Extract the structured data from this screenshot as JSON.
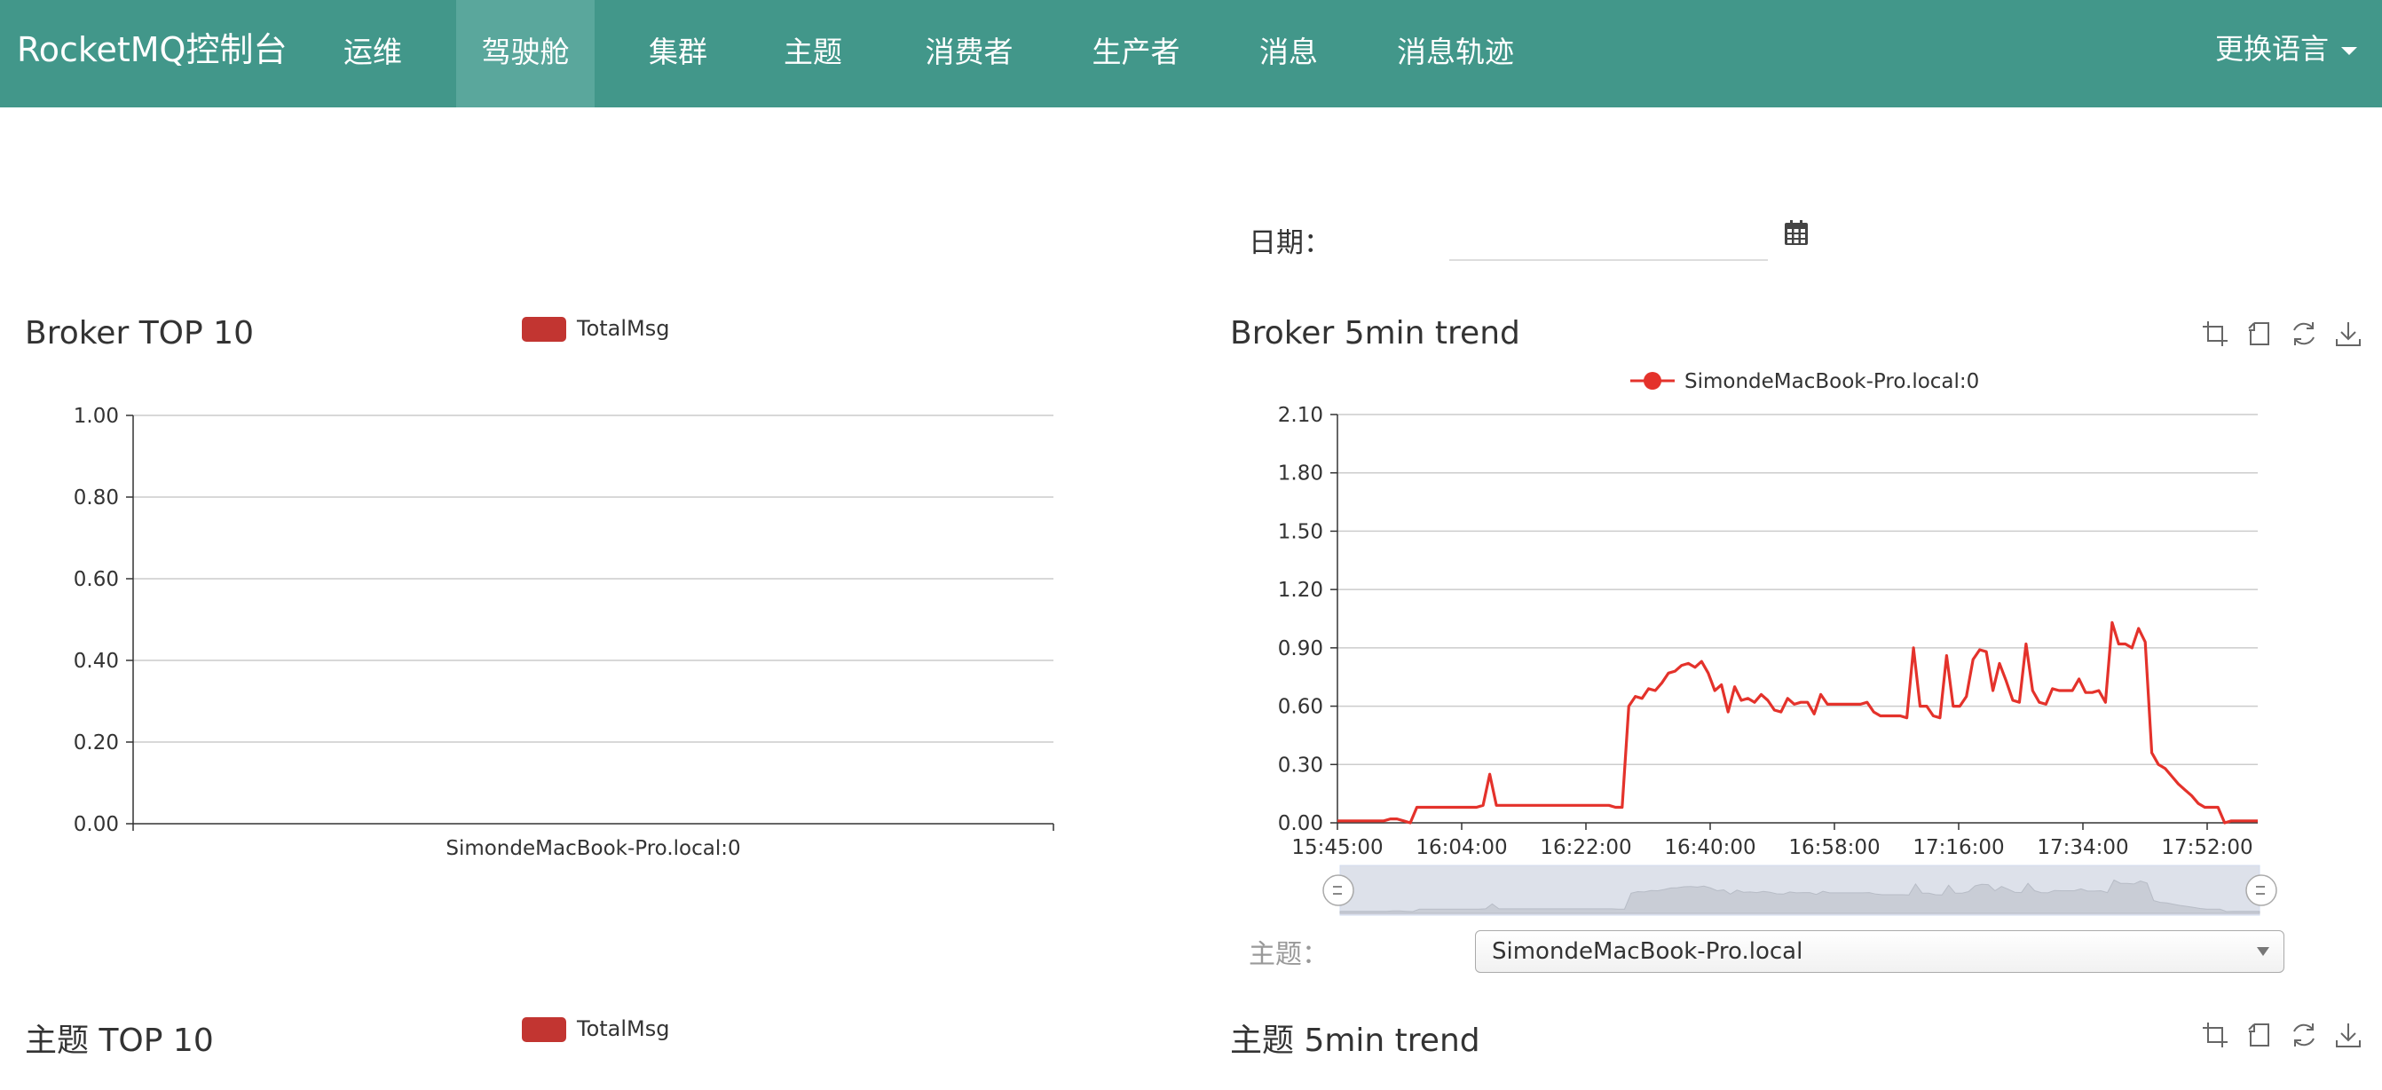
{
  "navbar": {
    "brand": "RocketMQ控制台",
    "items": [
      {
        "label": "运维",
        "active": false
      },
      {
        "label": "驾驶舱",
        "active": true
      },
      {
        "label": "集群",
        "active": false
      },
      {
        "label": "主题",
        "active": false
      },
      {
        "label": "消费者",
        "active": false
      },
      {
        "label": "生产者",
        "active": false
      },
      {
        "label": "消息",
        "active": false
      },
      {
        "label": "消息轨迹",
        "active": false
      }
    ],
    "language_label": "更换语言"
  },
  "date_filter": {
    "label": "日期：",
    "value": "",
    "icon": "calendar-icon"
  },
  "broker_top": {
    "title": "Broker TOP 10",
    "legend": "TotalMsg"
  },
  "broker_trend": {
    "title": "Broker 5min trend",
    "tools": [
      "zoom-icon",
      "zoom-reset-icon",
      "restore-icon",
      "save-image-icon"
    ]
  },
  "topic_filter": {
    "label": "主题：",
    "selected": "SimondeMacBook-Pro.local"
  },
  "topic_top": {
    "title": "主题 TOP 10",
    "legend": "TotalMsg"
  },
  "topic_trend": {
    "title": "主题 5min trend"
  },
  "chart_data": [
    {
      "type": "bar",
      "categories": [
        "SimondeMacBook-Pro.local:0"
      ],
      "series": [
        {
          "name": "TotalMsg",
          "values": [
            0
          ]
        }
      ],
      "ylim": [
        0,
        1
      ],
      "yticks": [
        "0.00",
        "0.20",
        "0.40",
        "0.60",
        "0.80",
        "1.00"
      ],
      "color": "#c23531",
      "legend": "top"
    },
    {
      "type": "line",
      "x_ticks": [
        "15:45:00",
        "16:04:00",
        "16:22:00",
        "16:40:00",
        "16:58:00",
        "17:16:00",
        "17:34:00",
        "17:52:00"
      ],
      "ylim": [
        0,
        2.1
      ],
      "yticks": [
        "0.00",
        "0.30",
        "0.60",
        "0.90",
        "1.20",
        "1.50",
        "1.80",
        "2.10"
      ],
      "series": [
        {
          "name": "SimondeMacBook-Pro.local:0",
          "color": "#e4322b",
          "values": [
            0.01,
            0.01,
            0.01,
            0.01,
            0.01,
            0.01,
            0.01,
            0.01,
            0.02,
            0.02,
            0.01,
            0.0,
            0.08,
            0.08,
            0.08,
            0.08,
            0.08,
            0.08,
            0.08,
            0.08,
            0.08,
            0.08,
            0.09,
            0.25,
            0.09,
            0.09,
            0.09,
            0.09,
            0.09,
            0.09,
            0.09,
            0.09,
            0.09,
            0.09,
            0.09,
            0.09,
            0.09,
            0.09,
            0.09,
            0.09,
            0.09,
            0.09,
            0.08,
            0.08,
            0.6,
            0.65,
            0.64,
            0.69,
            0.68,
            0.72,
            0.77,
            0.78,
            0.81,
            0.82,
            0.8,
            0.83,
            0.77,
            0.68,
            0.71,
            0.57,
            0.7,
            0.63,
            0.64,
            0.62,
            0.66,
            0.63,
            0.58,
            0.57,
            0.64,
            0.61,
            0.62,
            0.62,
            0.56,
            0.66,
            0.61,
            0.61,
            0.61,
            0.61,
            0.61,
            0.61,
            0.62,
            0.57,
            0.55,
            0.55,
            0.55,
            0.55,
            0.54,
            0.9,
            0.6,
            0.6,
            0.55,
            0.54,
            0.86,
            0.6,
            0.6,
            0.65,
            0.84,
            0.89,
            0.88,
            0.68,
            0.82,
            0.73,
            0.63,
            0.62,
            0.92,
            0.68,
            0.62,
            0.61,
            0.69,
            0.68,
            0.68,
            0.68,
            0.74,
            0.67,
            0.67,
            0.68,
            0.62,
            1.03,
            0.92,
            0.92,
            0.9,
            1.0,
            0.93,
            0.36,
            0.3,
            0.28,
            0.24,
            0.2,
            0.17,
            0.14,
            0.1,
            0.08,
            0.08,
            0.08,
            0.0,
            0.01,
            0.01,
            0.01,
            0.01,
            0.01
          ],
          "marker": "circle"
        }
      ],
      "legend": "top-center",
      "datazoom": true
    },
    {
      "type": "bar",
      "series": [
        {
          "name": "TotalMsg",
          "values": []
        }
      ],
      "legend": "top"
    }
  ]
}
